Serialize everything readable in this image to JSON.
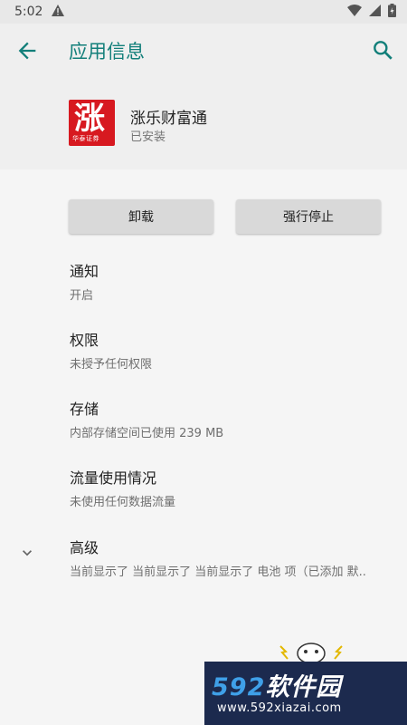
{
  "status_bar": {
    "time": "5:02"
  },
  "app_bar": {
    "title": "应用信息"
  },
  "app": {
    "icon_glyph": "涨",
    "icon_caption": "华泰证券",
    "name": "涨乐财富通",
    "status": "已安装",
    "brand_color": "#d71920"
  },
  "buttons": {
    "uninstall": "卸载",
    "force_stop": "强行停止"
  },
  "settings": [
    {
      "title": "通知",
      "summary": "开启"
    },
    {
      "title": "权限",
      "summary": "未授予任何权限"
    },
    {
      "title": "存储",
      "summary": "内部存储空间已使用 239 MB"
    },
    {
      "title": "流量使用情况",
      "summary": "未使用任何数据流量"
    },
    {
      "title": "高级",
      "summary": "当前显示了 当前显示了 当前显示了 电池 项（已添加 默.."
    }
  ],
  "watermark": {
    "brand_num": "592",
    "brand_text": "软件园",
    "url": "www.592xiazai.com"
  },
  "colors": {
    "accent": "#127f7a",
    "background": "#f5f5f5"
  }
}
